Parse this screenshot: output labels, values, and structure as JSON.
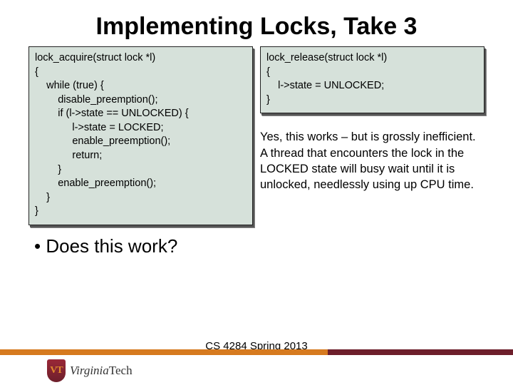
{
  "title": "Implementing Locks, Take 3",
  "code_left": "lock_acquire(struct lock *l)\n{\n    while (true) {\n        disable_preemption();\n        if (l->state == UNLOCKED) {\n             l->state = LOCKED;\n             enable_preemption();\n             return;\n        }\n        enable_preemption();\n    }\n}",
  "code_right": "lock_release(struct lock *l)\n{\n    l->state = UNLOCKED;\n}",
  "bullet": "• Does this work?",
  "analysis": "Yes, this works – but is grossly\ninefficient. A thread that\nencounters\nthe lock in the LOCKED state\nwill busy wait until it is\nunlocked,\nneedlessly using up CPU time.",
  "footer": "CS 4284 Spring 2013",
  "logo_text_italic": "Virginia",
  "logo_text_rest": "Tech"
}
